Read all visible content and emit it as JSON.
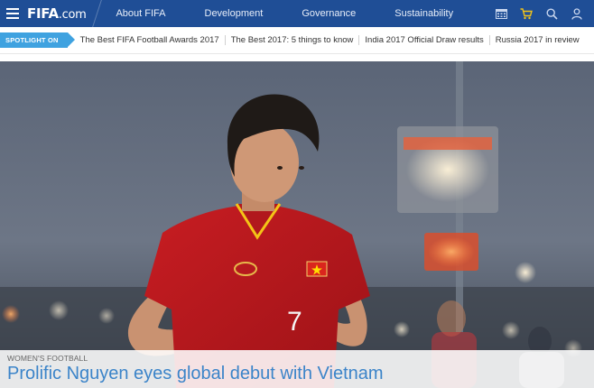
{
  "header": {
    "logo_main": "FIFA",
    "logo_suffix": ".com",
    "nav": [
      "About FIFA",
      "Development",
      "Governance",
      "Sustainability"
    ],
    "icons": [
      "calendar-icon",
      "cart-icon",
      "search-icon",
      "user-icon"
    ],
    "bg_color": "#1f4e96"
  },
  "spotlight": {
    "badge": "SPOTLIGHT ON",
    "links": [
      "The Best FIFA Football Awards 2017",
      "The Best 2017: 5 things to know",
      "India 2017 Official Draw results",
      "Russia 2017 in review"
    ],
    "accent_color": "#3fa2e0"
  },
  "hero": {
    "shirt_number": "7",
    "category": "WOMEN'S FOOTBALL",
    "title": "Prolific Nguyen eyes global debut with Vietnam",
    "title_color": "#3b84c9"
  }
}
